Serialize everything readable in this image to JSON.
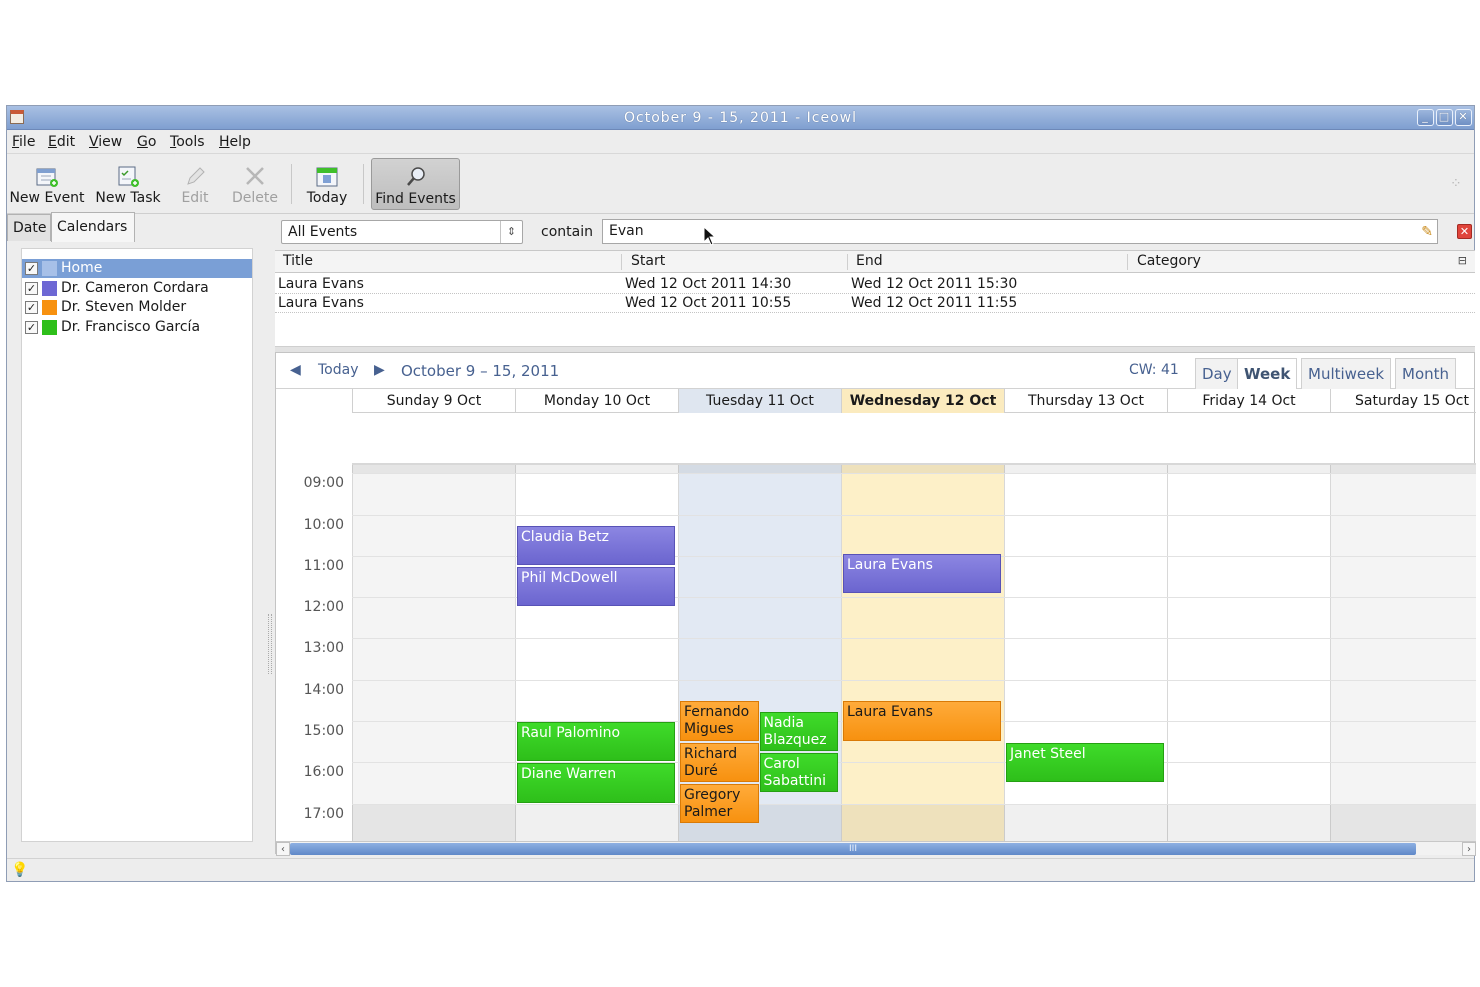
{
  "window": {
    "title": "October 9 - 15, 2011 - Iceowl",
    "controls": [
      "_",
      "□",
      "✕"
    ]
  },
  "menubar": [
    {
      "key": "F",
      "rest": "ile"
    },
    {
      "key": "E",
      "rest": "dit"
    },
    {
      "key": "V",
      "rest": "iew"
    },
    {
      "key": "G",
      "rest": "o"
    },
    {
      "key": "T",
      "rest": "ools"
    },
    {
      "key": "H",
      "rest": "elp"
    }
  ],
  "toolbar": {
    "new_event": "New Event",
    "new_task": "New Task",
    "edit": "Edit",
    "delete": "Delete",
    "today": "Today",
    "find_events": "Find Events"
  },
  "left_tabs": {
    "date": "Date",
    "calendars": "Calendars"
  },
  "calendars": [
    {
      "name": "Home",
      "checked": true,
      "color": "#a7c0e8",
      "selected": true
    },
    {
      "name": "Dr. Cameron Cordara",
      "checked": true,
      "color": "#6d67d4"
    },
    {
      "name": "Dr. Steven Molder",
      "checked": true,
      "color": "#f7910f"
    },
    {
      "name": "Dr. Francisco García",
      "checked": true,
      "color": "#2ebf1a"
    }
  ],
  "search": {
    "filter": "All Events",
    "contain_label": "contain",
    "query": "Evan"
  },
  "results": {
    "columns": [
      "Title",
      "Start",
      "End",
      "Category"
    ],
    "rows": [
      {
        "title": "Laura Evans",
        "start": "Wed 12 Oct 2011 14:30",
        "end": "Wed 12 Oct 2011 15:30",
        "category": ""
      },
      {
        "title": "Laura Evans",
        "start": "Wed 12 Oct 2011 10:55",
        "end": "Wed 12 Oct 2011 11:55",
        "category": ""
      }
    ]
  },
  "calendar_nav": {
    "prev": "◀",
    "today": "Today",
    "next": "▶",
    "range": "October 9 – 15, 2011",
    "week_number": "CW: 41",
    "views": [
      "Day",
      "Week",
      "Multiweek",
      "Month"
    ],
    "selected_view": "Week"
  },
  "days": [
    {
      "label": "Sunday 9 Oct"
    },
    {
      "label": "Monday 10 Oct"
    },
    {
      "label": "Tuesday 11 Oct",
      "selected": true
    },
    {
      "label": "Wednesday 12 Oct",
      "today": true
    },
    {
      "label": "Thursday 13 Oct"
    },
    {
      "label": "Friday 14 Oct"
    },
    {
      "label": "Saturday 15 Oct"
    }
  ],
  "hours": [
    "09:00",
    "10:00",
    "11:00",
    "12:00",
    "13:00",
    "14:00",
    "15:00",
    "16:00",
    "17:00"
  ],
  "events": [
    {
      "title": "Claudia Betz",
      "day": 1,
      "start": 10.25,
      "end": 11.25,
      "color": "purple"
    },
    {
      "title": "Phil McDowell",
      "day": 1,
      "start": 11.25,
      "end": 12.25,
      "color": "purple"
    },
    {
      "title": "Laura Evans",
      "day": 3,
      "start": 10.92,
      "end": 11.92,
      "color": "purple"
    },
    {
      "title": "Raul Palomino",
      "day": 1,
      "start": 15.0,
      "end": 16.0,
      "color": "green"
    },
    {
      "title": "Diane Warren",
      "day": 1,
      "start": 16.0,
      "end": 17.0,
      "color": "green"
    },
    {
      "title": "Fernando Migues",
      "day": 2,
      "start": 14.5,
      "end": 15.5,
      "color": "orange",
      "lane": 0,
      "lanes": 2
    },
    {
      "title": "Richard Duré",
      "day": 2,
      "start": 15.5,
      "end": 16.5,
      "color": "orange",
      "lane": 0,
      "lanes": 2
    },
    {
      "title": "Gregory Palmer",
      "day": 2,
      "start": 16.5,
      "end": 17.5,
      "color": "orange",
      "lane": 0,
      "lanes": 2
    },
    {
      "title": "Nadia Blazquez",
      "day": 2,
      "start": 14.75,
      "end": 15.75,
      "color": "green",
      "lane": 1,
      "lanes": 2
    },
    {
      "title": "Carol Sabattini",
      "day": 2,
      "start": 15.75,
      "end": 16.75,
      "color": "green",
      "lane": 1,
      "lanes": 2
    },
    {
      "title": "Laura Evans",
      "day": 3,
      "start": 14.5,
      "end": 15.5,
      "color": "orange"
    },
    {
      "title": "Janet Steel",
      "day": 4,
      "start": 15.5,
      "end": 16.5,
      "color": "green"
    }
  ],
  "scroll_grip": "III"
}
